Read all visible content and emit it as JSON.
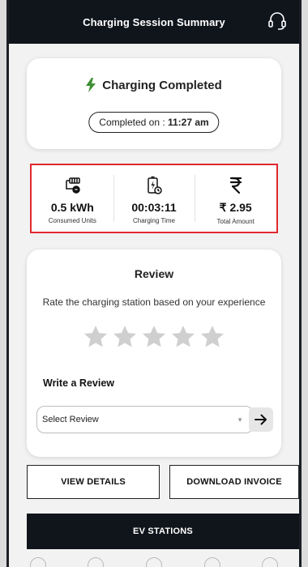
{
  "header": {
    "title": "Charging Session Summary",
    "support_icon": "headset-icon"
  },
  "status": {
    "icon": "lightning-bolt-icon",
    "text": "Charging Completed",
    "completed_label": "Completed on : ",
    "completed_time": "11:27 am"
  },
  "stats": [
    {
      "icon": "charger-plug-icon",
      "value": "0.5 kWh",
      "label": "Consumed Units"
    },
    {
      "icon": "battery-timer-icon",
      "value": "00:03:11",
      "label": "Charging Time"
    },
    {
      "icon": "rupee-icon",
      "value": "₹ 2.95",
      "label": "Total Amount"
    }
  ],
  "review": {
    "title": "Review",
    "subtitle": "Rate the charging station based on your experience",
    "rating": 0,
    "max_rating": 5,
    "write_title": "Write a Review",
    "select_placeholder": "Select Review"
  },
  "buttons": {
    "view_details": "VIEW DETAILS",
    "download_invoice": "DOWNLOAD INVOICE",
    "ev_stations": "EV STATIONS"
  },
  "colors": {
    "header_bg": "#10151c",
    "accent_green": "#3e8e33",
    "highlight_red": "#e0292e",
    "star_gray": "#cfcfcf"
  }
}
